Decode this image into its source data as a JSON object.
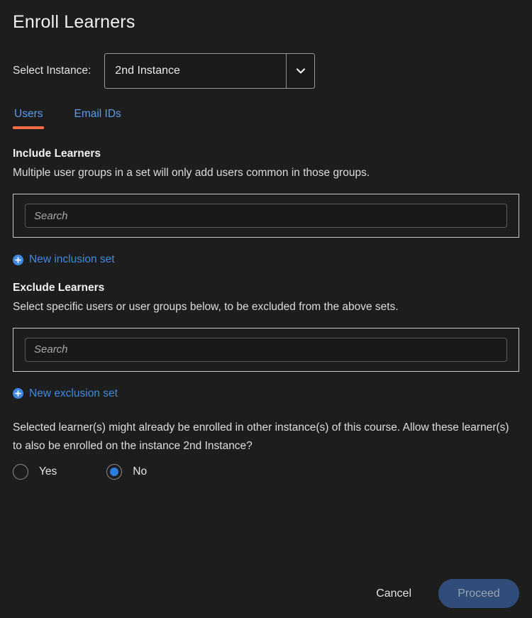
{
  "dialog": {
    "title": "Enroll Learners"
  },
  "instance": {
    "label": "Select Instance:",
    "selected": "2nd Instance",
    "chevron_icon": "chevron-down-icon"
  },
  "tabs": [
    {
      "label": "Users",
      "active": true
    },
    {
      "label": "Email IDs",
      "active": false
    }
  ],
  "include": {
    "heading": "Include Learners",
    "description": "Multiple user groups in a set will only add users common in those groups.",
    "search_value": "",
    "search_placeholder": "Search",
    "add_set_label": "New inclusion set",
    "add_set_icon": "plus-circle-icon"
  },
  "exclude": {
    "heading": "Exclude Learners",
    "description": "Select specific users or user groups below, to be excluded from the above sets.",
    "search_value": "",
    "search_placeholder": "Search",
    "add_set_label": "New exclusion set",
    "add_set_icon": "plus-circle-icon"
  },
  "allow_prompt": {
    "text": "Selected learner(s) might already be enrolled in other instance(s) of this course. Allow these learner(s) to also be enrolled on the instance 2nd Instance?",
    "options": [
      {
        "label": "Yes",
        "checked": false
      },
      {
        "label": "No",
        "checked": true
      }
    ]
  },
  "footer": {
    "cancel_label": "Cancel",
    "proceed_label": "Proceed"
  },
  "colors": {
    "background": "#1d1d1d",
    "accent_tab_underline": "#f16b45",
    "link_blue": "#3f8ae0",
    "tab_blue": "#5e9ae8",
    "radio_selected": "#2b7de0",
    "proceed_disabled_bg": "#2f4d78",
    "proceed_disabled_text": "#9aa4b0"
  }
}
